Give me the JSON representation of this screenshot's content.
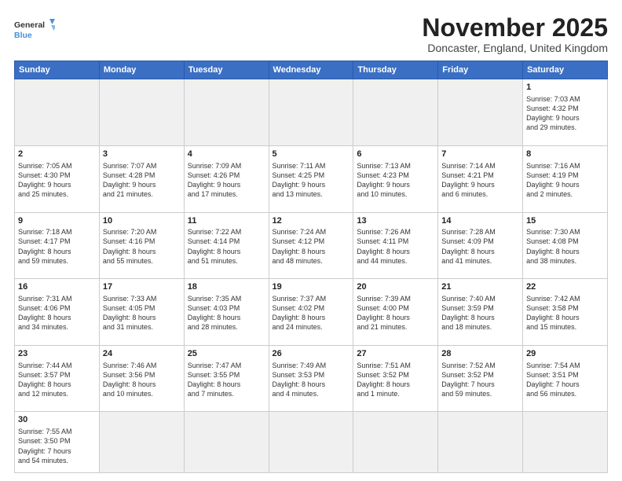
{
  "header": {
    "logo_general": "General",
    "logo_blue": "Blue",
    "month_title": "November 2025",
    "subtitle": "Doncaster, England, United Kingdom"
  },
  "weekdays": [
    "Sunday",
    "Monday",
    "Tuesday",
    "Wednesday",
    "Thursday",
    "Friday",
    "Saturday"
  ],
  "weeks": [
    [
      {
        "day": "",
        "info": ""
      },
      {
        "day": "",
        "info": ""
      },
      {
        "day": "",
        "info": ""
      },
      {
        "day": "",
        "info": ""
      },
      {
        "day": "",
        "info": ""
      },
      {
        "day": "",
        "info": ""
      },
      {
        "day": "1",
        "info": "Sunrise: 7:03 AM\nSunset: 4:32 PM\nDaylight: 9 hours\nand 29 minutes."
      }
    ],
    [
      {
        "day": "2",
        "info": "Sunrise: 7:05 AM\nSunset: 4:30 PM\nDaylight: 9 hours\nand 25 minutes."
      },
      {
        "day": "3",
        "info": "Sunrise: 7:07 AM\nSunset: 4:28 PM\nDaylight: 9 hours\nand 21 minutes."
      },
      {
        "day": "4",
        "info": "Sunrise: 7:09 AM\nSunset: 4:26 PM\nDaylight: 9 hours\nand 17 minutes."
      },
      {
        "day": "5",
        "info": "Sunrise: 7:11 AM\nSunset: 4:25 PM\nDaylight: 9 hours\nand 13 minutes."
      },
      {
        "day": "6",
        "info": "Sunrise: 7:13 AM\nSunset: 4:23 PM\nDaylight: 9 hours\nand 10 minutes."
      },
      {
        "day": "7",
        "info": "Sunrise: 7:14 AM\nSunset: 4:21 PM\nDaylight: 9 hours\nand 6 minutes."
      },
      {
        "day": "8",
        "info": "Sunrise: 7:16 AM\nSunset: 4:19 PM\nDaylight: 9 hours\nand 2 minutes."
      }
    ],
    [
      {
        "day": "9",
        "info": "Sunrise: 7:18 AM\nSunset: 4:17 PM\nDaylight: 8 hours\nand 59 minutes."
      },
      {
        "day": "10",
        "info": "Sunrise: 7:20 AM\nSunset: 4:16 PM\nDaylight: 8 hours\nand 55 minutes."
      },
      {
        "day": "11",
        "info": "Sunrise: 7:22 AM\nSunset: 4:14 PM\nDaylight: 8 hours\nand 51 minutes."
      },
      {
        "day": "12",
        "info": "Sunrise: 7:24 AM\nSunset: 4:12 PM\nDaylight: 8 hours\nand 48 minutes."
      },
      {
        "day": "13",
        "info": "Sunrise: 7:26 AM\nSunset: 4:11 PM\nDaylight: 8 hours\nand 44 minutes."
      },
      {
        "day": "14",
        "info": "Sunrise: 7:28 AM\nSunset: 4:09 PM\nDaylight: 8 hours\nand 41 minutes."
      },
      {
        "day": "15",
        "info": "Sunrise: 7:30 AM\nSunset: 4:08 PM\nDaylight: 8 hours\nand 38 minutes."
      }
    ],
    [
      {
        "day": "16",
        "info": "Sunrise: 7:31 AM\nSunset: 4:06 PM\nDaylight: 8 hours\nand 34 minutes."
      },
      {
        "day": "17",
        "info": "Sunrise: 7:33 AM\nSunset: 4:05 PM\nDaylight: 8 hours\nand 31 minutes."
      },
      {
        "day": "18",
        "info": "Sunrise: 7:35 AM\nSunset: 4:03 PM\nDaylight: 8 hours\nand 28 minutes."
      },
      {
        "day": "19",
        "info": "Sunrise: 7:37 AM\nSunset: 4:02 PM\nDaylight: 8 hours\nand 24 minutes."
      },
      {
        "day": "20",
        "info": "Sunrise: 7:39 AM\nSunset: 4:00 PM\nDaylight: 8 hours\nand 21 minutes."
      },
      {
        "day": "21",
        "info": "Sunrise: 7:40 AM\nSunset: 3:59 PM\nDaylight: 8 hours\nand 18 minutes."
      },
      {
        "day": "22",
        "info": "Sunrise: 7:42 AM\nSunset: 3:58 PM\nDaylight: 8 hours\nand 15 minutes."
      }
    ],
    [
      {
        "day": "23",
        "info": "Sunrise: 7:44 AM\nSunset: 3:57 PM\nDaylight: 8 hours\nand 12 minutes."
      },
      {
        "day": "24",
        "info": "Sunrise: 7:46 AM\nSunset: 3:56 PM\nDaylight: 8 hours\nand 10 minutes."
      },
      {
        "day": "25",
        "info": "Sunrise: 7:47 AM\nSunset: 3:55 PM\nDaylight: 8 hours\nand 7 minutes."
      },
      {
        "day": "26",
        "info": "Sunrise: 7:49 AM\nSunset: 3:53 PM\nDaylight: 8 hours\nand 4 minutes."
      },
      {
        "day": "27",
        "info": "Sunrise: 7:51 AM\nSunset: 3:52 PM\nDaylight: 8 hours\nand 1 minute."
      },
      {
        "day": "28",
        "info": "Sunrise: 7:52 AM\nSunset: 3:52 PM\nDaylight: 7 hours\nand 59 minutes."
      },
      {
        "day": "29",
        "info": "Sunrise: 7:54 AM\nSunset: 3:51 PM\nDaylight: 7 hours\nand 56 minutes."
      }
    ],
    [
      {
        "day": "30",
        "info": "Sunrise: 7:55 AM\nSunset: 3:50 PM\nDaylight: 7 hours\nand 54 minutes."
      },
      {
        "day": "",
        "info": ""
      },
      {
        "day": "",
        "info": ""
      },
      {
        "day": "",
        "info": ""
      },
      {
        "day": "",
        "info": ""
      },
      {
        "day": "",
        "info": ""
      },
      {
        "day": "",
        "info": ""
      }
    ]
  ]
}
